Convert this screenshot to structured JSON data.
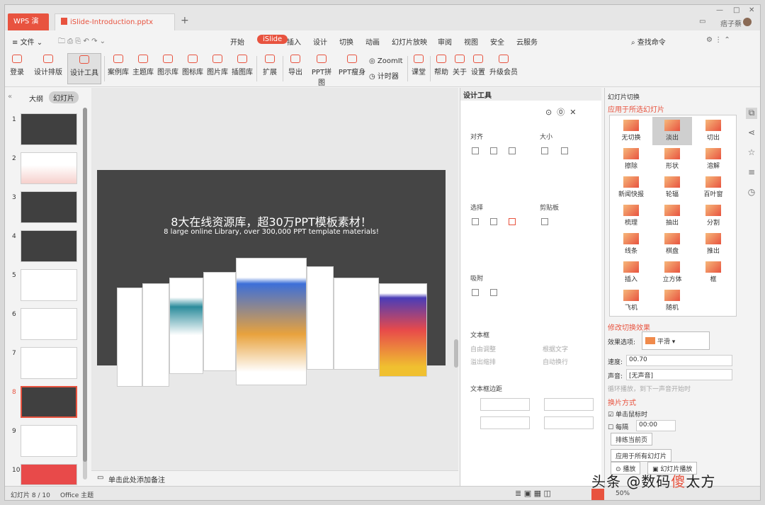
{
  "tabs": {
    "app": "WPS 演示",
    "doc": "iSlide-Introduction.pptx",
    "add": "+"
  },
  "user": "痞子蔡",
  "menu": {
    "file": "文件",
    "items": [
      "开始",
      "iSlide",
      "插入",
      "设计",
      "切换",
      "动画",
      "幻灯片放映",
      "审阅",
      "视图",
      "安全",
      "云服务"
    ],
    "search": "查找命令"
  },
  "ribbon": [
    "登录",
    "设计排版",
    "设计工具",
    "案例库",
    "主题库",
    "图示库",
    "图标库",
    "图片库",
    "插图库",
    "扩展",
    "导出",
    "PPT拼图",
    "PPT瘦身",
    "ZoomIt",
    "计时器",
    "课堂",
    "帮助",
    "关于",
    "设置",
    "升级会员"
  ],
  "left": {
    "tab_outline": "大纲",
    "tab_slides": "幻灯片",
    "nums": [
      "1",
      "2",
      "3",
      "4",
      "5",
      "6",
      "7",
      "8",
      "9",
      "10"
    ]
  },
  "slide": {
    "title": "8大在线资源库，超30万PPT模板素材！",
    "subtitle": "8 large online Library, over 300,000 PPT template materials!"
  },
  "notes": "单击此处添加备注",
  "tool": {
    "title": "设计工具",
    "align": "对齐",
    "size": "大小",
    "select": "选择",
    "clipboard": "剪贴板",
    "snap": "吸附",
    "textbox": "文本框",
    "autofit": "自由调整",
    "wrap": "根据文字",
    "overflow": "溢出缩排",
    "autowrap": "自动换行",
    "margin": "文本框边距"
  },
  "trans": {
    "head": "幻灯片切换",
    "apply_sel": "应用于所选幻灯片",
    "effects": [
      "无切换",
      "淡出",
      "切出",
      "擦除",
      "形状",
      "溶解",
      "新闻快报",
      "轮辐",
      "百叶窗",
      "梳理",
      "抽出",
      "分割",
      "线条",
      "棋盘",
      "推出",
      "插入",
      "立方体",
      "框",
      "飞机",
      "随机"
    ],
    "modify": "修改切换效果",
    "opt_label": "效果选项:",
    "opt_val": "平滑",
    "speed_label": "速度:",
    "speed": "00.70",
    "sound_label": "声音:",
    "sound": "[无声音]",
    "loop": "循环播放，到下一声音开始时",
    "mode": "换片方式",
    "click": "单击鼠标时",
    "every": "每隔",
    "every_val": "00:00",
    "rehearse": "排练当前页",
    "apply_all": "应用于所有幻灯片",
    "play": "播放",
    "slideshow": "幻灯片播放"
  },
  "status": {
    "page": "幻灯片 8 / 10",
    "theme": "Office 主题",
    "zoom": "50%"
  },
  "watermark": {
    "a": "头条 @数码",
    "b": "傻",
    "c": "太方"
  }
}
